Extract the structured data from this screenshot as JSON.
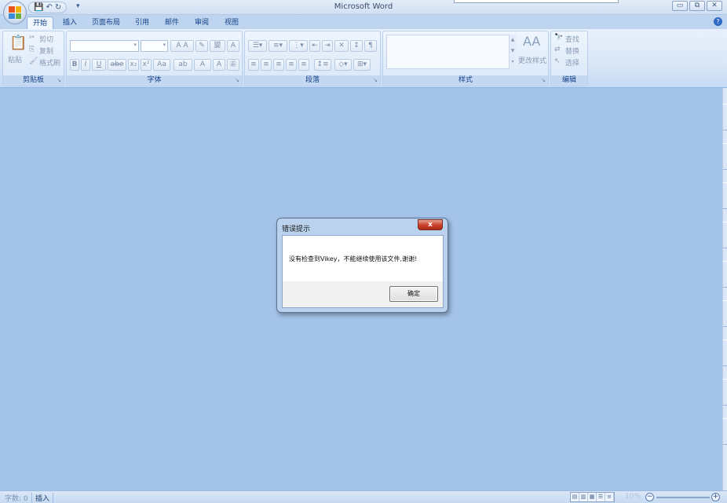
{
  "app": {
    "title": "Microsoft Word"
  },
  "window_controls": {
    "minimize": "▭",
    "restore": "⧉",
    "close": "✕"
  },
  "qat": {
    "save": "💾",
    "undo": "↶",
    "redo": "↻",
    "more": "▾"
  },
  "tabs": [
    {
      "label": "开始",
      "active": true
    },
    {
      "label": "插入"
    },
    {
      "label": "页面布局"
    },
    {
      "label": "引用"
    },
    {
      "label": "邮件"
    },
    {
      "label": "审阅"
    },
    {
      "label": "视图"
    }
  ],
  "help": "?",
  "ribbon": {
    "clipboard": {
      "label": "剪贴板",
      "paste": "粘贴",
      "cut": "剪切",
      "copy": "复制",
      "format_painter": "格式刷"
    },
    "font": {
      "label": "字体",
      "grow": "A",
      "shrink": "A",
      "clear": "✎",
      "phonetic": "變",
      "border": "A",
      "bold": "B",
      "italic": "I",
      "underline": "U",
      "strike": "abe",
      "subscript": "x₂",
      "superscript": "x²",
      "case": "Aa",
      "highlight": "ab",
      "color": "A",
      "shade": "A",
      "circle": "㊣"
    },
    "paragraph": {
      "label": "段落"
    },
    "styles": {
      "label": "样式",
      "change_styles": "更改样式",
      "big_a": "AA"
    },
    "editing": {
      "label": "编辑",
      "find": "查找",
      "replace": "替换",
      "select": "选择"
    }
  },
  "status": {
    "word_count": "字数: 0",
    "insert_mode": "插入",
    "zoom": "10%"
  },
  "dialog": {
    "title": "错误提示",
    "close": "x",
    "message": "没有检查到Vikey，不能继续使用该文件,谢谢!",
    "ok": "确定"
  },
  "colors": {
    "workspace": "#a4c3e9",
    "ribbon": "#dae7f7",
    "accent_text": "#15428b",
    "close_red": "#c8402a"
  }
}
